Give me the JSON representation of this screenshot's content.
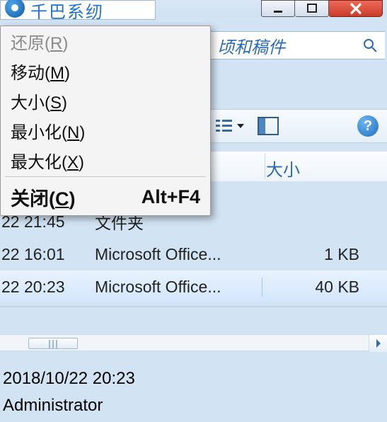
{
  "titlebar": {
    "app_text": "千巴系纫"
  },
  "caption": {
    "minimize": "minimize",
    "restore": "restore",
    "close": "close"
  },
  "search": {
    "placeholder_text": "顷和稿件"
  },
  "toolbar": {
    "view_switch": "view",
    "preview_pane": "preview",
    "help": "?"
  },
  "columns": {
    "size_label": "大小"
  },
  "rows": [
    {
      "time": "22 21:45",
      "type": "文件夹",
      "size": ""
    },
    {
      "time": "22 16:01",
      "type": "Microsoft Office...",
      "size": "1 KB"
    },
    {
      "time": "22 20:23",
      "type": "Microsoft Office...",
      "size": "40 KB"
    }
  ],
  "status": {
    "date": "2018/10/22 20:23",
    "user": "Administrator"
  },
  "sysmenu": {
    "restore": {
      "pre": "还原(",
      "key": "R",
      "post": ")"
    },
    "move": {
      "pre": "移动(",
      "key": "M",
      "post": ")"
    },
    "size": {
      "pre": "大小(",
      "key": "S",
      "post": ")"
    },
    "minimize": {
      "pre": "最小化(",
      "key": "N",
      "post": ")"
    },
    "maximize": {
      "pre": "最大化(",
      "key": "X",
      "post": ")"
    },
    "close": {
      "pre": "关闭(",
      "key": "C",
      "post": ")",
      "accel": "Alt+F4"
    }
  }
}
